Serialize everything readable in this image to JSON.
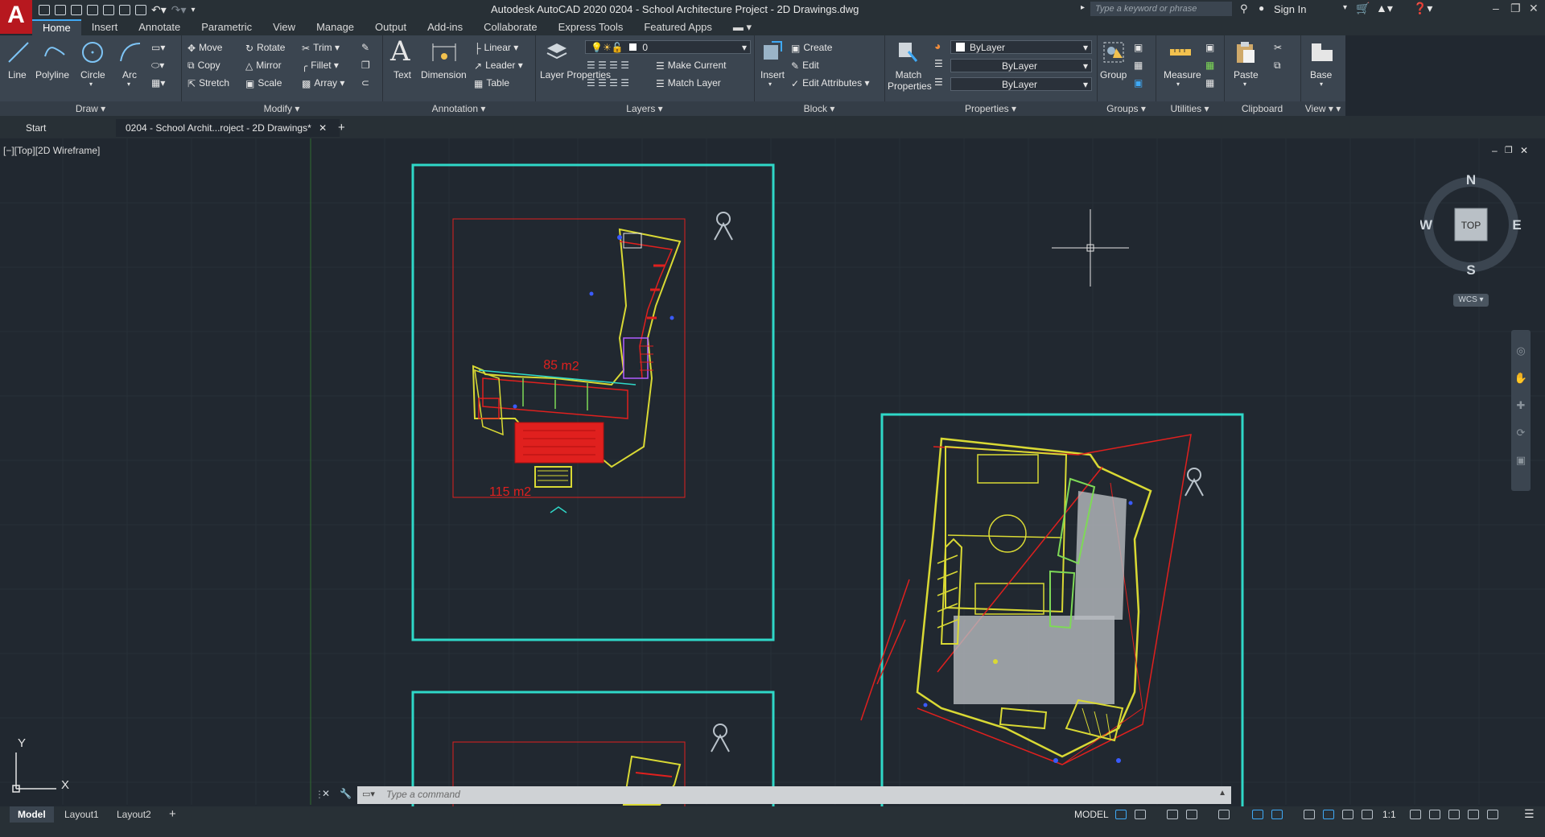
{
  "app": {
    "logo": "A",
    "title": "Autodesk AutoCAD 2020   0204 - School Architecture Project - 2D Drawings.dwg",
    "search_placeholder": "Type a keyword or phrase",
    "signin": "Sign In"
  },
  "menu": [
    "Home",
    "Insert",
    "Annotate",
    "Parametric",
    "View",
    "Manage",
    "Output",
    "Add-ins",
    "Collaborate",
    "Express Tools",
    "Featured Apps"
  ],
  "ribbon": {
    "draw": {
      "title": "Draw",
      "line": "Line",
      "polyline": "Polyline",
      "circle": "Circle",
      "arc": "Arc"
    },
    "modify": {
      "title": "Modify",
      "move": "Move",
      "rotate": "Rotate",
      "trim": "Trim",
      "copy": "Copy",
      "mirror": "Mirror",
      "fillet": "Fillet",
      "stretch": "Stretch",
      "scale": "Scale",
      "array": "Array"
    },
    "annotation": {
      "title": "Annotation",
      "text": "Text",
      "dimension": "Dimension",
      "linear": "Linear",
      "leader": "Leader",
      "table": "Table"
    },
    "layers": {
      "title": "Layers",
      "layer_properties": "Layer Properties",
      "current_layer": "0",
      "make_current": "Make Current",
      "match_layer": "Match Layer"
    },
    "block": {
      "title": "Block",
      "insert": "Insert",
      "create": "Create",
      "edit": "Edit",
      "edit_attributes": "Edit Attributes"
    },
    "properties": {
      "title": "Properties",
      "match_properties": "Match Properties",
      "color": "ByLayer",
      "linetype": "ByLayer",
      "lineweight": "ByLayer"
    },
    "groups": {
      "title": "Groups",
      "group": "Group"
    },
    "utilities": {
      "title": "Utilities",
      "measure": "Measure"
    },
    "clipboard": {
      "title": "Clipboard",
      "paste": "Paste"
    },
    "view": {
      "title": "View",
      "base": "Base"
    }
  },
  "doctabs": {
    "start": "Start",
    "active": "0204 - School Archit...roject - 2D Drawings*"
  },
  "viewport": {
    "label": "[−][Top][2D Wireframe]",
    "viewcube_top": "TOP",
    "compass": {
      "n": "N",
      "s": "S",
      "e": "E",
      "w": "W"
    },
    "wcs": "WCS",
    "ucs_x": "X",
    "ucs_y": "Y"
  },
  "drawing_labels": {
    "area_upper": "85 m2",
    "area_lower": "115 m2"
  },
  "command": {
    "placeholder": "Type  a  command"
  },
  "status": {
    "layouts": [
      "Model",
      "Layout1",
      "Layout2"
    ],
    "model": "MODEL",
    "scale": "1:1"
  },
  "colors": {
    "accent": "#3fa9f5",
    "sheet_border": "#2fd8c8",
    "plan_lines": "#d9d934",
    "red": "#e0201e"
  }
}
